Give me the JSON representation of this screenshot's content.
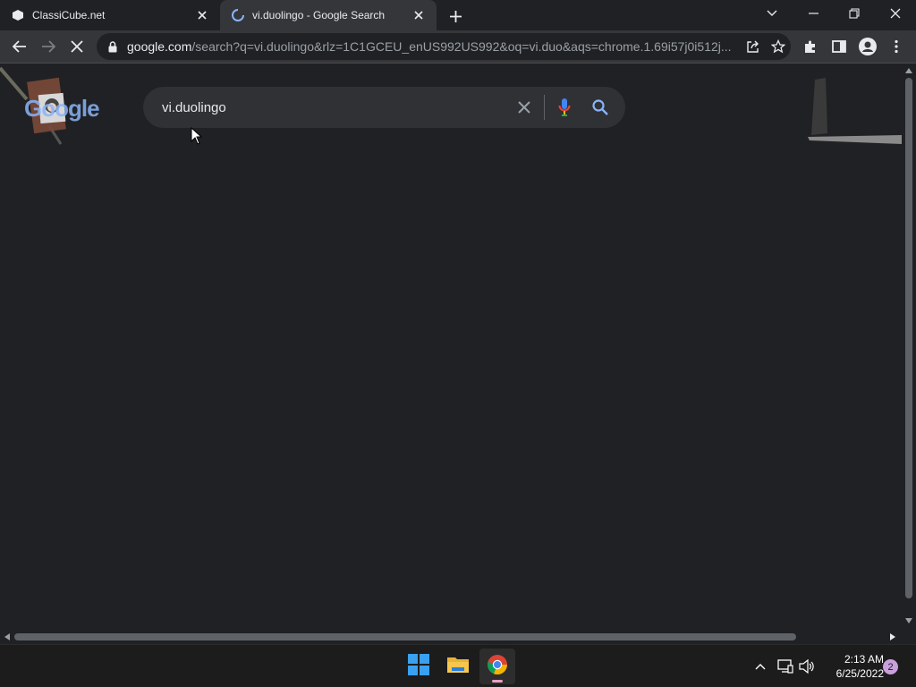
{
  "browser": {
    "tabs": [
      {
        "title": "ClassiCube.net",
        "icon": "classicube-icon",
        "active": false
      },
      {
        "title": "vi.duolingo - Google Search",
        "icon": "loading-spinner-icon",
        "active": true
      }
    ],
    "url_host": "google.com",
    "url_path": "/search?q=vi.duolingo&rlz=1C1GCEU_enUS992US992&oq=vi.duo&aqs=chrome.1.69i57j0i512j..."
  },
  "search": {
    "query": "vi.duolingo",
    "logo_text": "Google"
  },
  "taskbar": {
    "time": "2:13 AM",
    "date": "6/25/2022",
    "notifications": "2"
  },
  "colors": {
    "accent": "#8ab4f8",
    "page_bg": "#202124",
    "toolbar_bg": "#35363a"
  }
}
